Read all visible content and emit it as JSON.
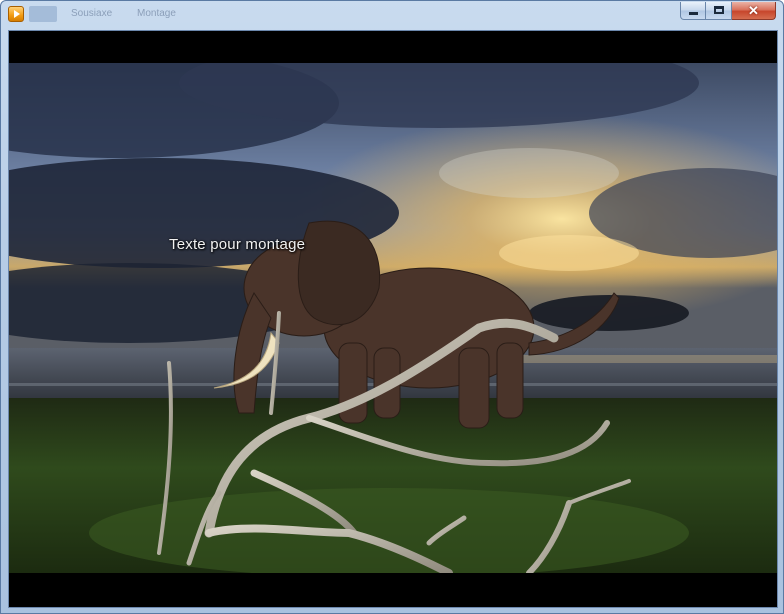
{
  "window": {
    "title": "",
    "menu": [
      "Sousiaxe",
      "Montage"
    ]
  },
  "caption_buttons": {
    "minimize_icon": "minimize-icon",
    "maximize_icon": "maximize-icon",
    "close_icon": "close-icon",
    "close_glyph": "✕"
  },
  "video": {
    "overlay_text": "Texte pour montage"
  },
  "colors": {
    "close_button": "#c7462c",
    "frame": "#b7cde6",
    "letterbox": "#000000"
  }
}
